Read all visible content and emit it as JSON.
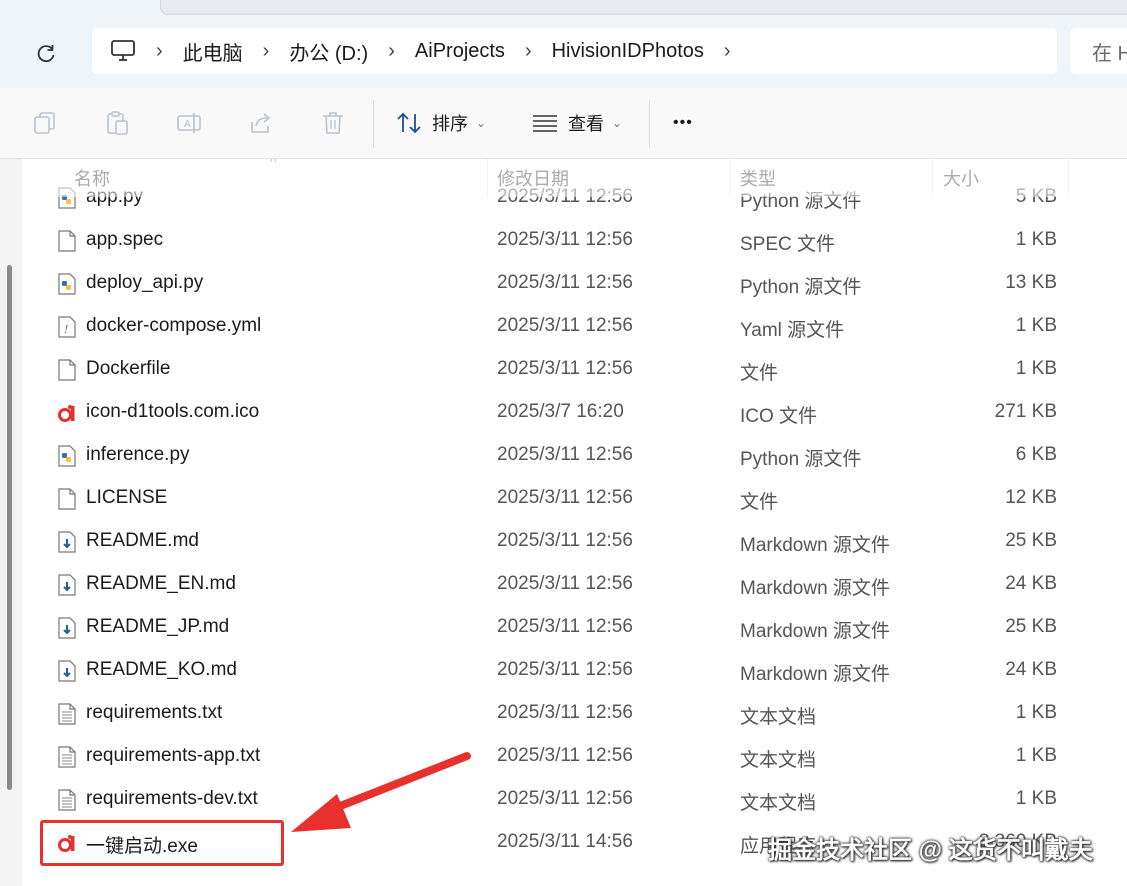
{
  "address": {
    "breadcrumbs": [
      "此电脑",
      "办公 (D:)",
      "AiProjects",
      "HivisionIDPhotos"
    ],
    "search_placeholder": "在 H"
  },
  "toolbar": {
    "sort_label": "排序",
    "view_label": "查看",
    "more_label": "•••"
  },
  "columns": {
    "name": "名称",
    "modified": "修改日期",
    "type": "类型",
    "size": "大小"
  },
  "files": [
    {
      "name": "app.py",
      "modified": "2025/3/11 12:56",
      "type": "Python 源文件",
      "size": "5 KB",
      "icon": "python-file-icon"
    },
    {
      "name": "app.spec",
      "modified": "2025/3/11 12:56",
      "type": "SPEC 文件",
      "size": "1 KB",
      "icon": "blank-file-icon"
    },
    {
      "name": "deploy_api.py",
      "modified": "2025/3/11 12:56",
      "type": "Python 源文件",
      "size": "13 KB",
      "icon": "python-file-icon"
    },
    {
      "name": "docker-compose.yml",
      "modified": "2025/3/11 12:56",
      "type": "Yaml 源文件",
      "size": "1 KB",
      "icon": "yaml-file-icon"
    },
    {
      "name": "Dockerfile",
      "modified": "2025/3/11 12:56",
      "type": "文件",
      "size": "1 KB",
      "icon": "blank-file-icon"
    },
    {
      "name": "icon-d1tools.com.ico",
      "modified": "2025/3/7 16:20",
      "type": "ICO 文件",
      "size": "271 KB",
      "icon": "app-logo-icon"
    },
    {
      "name": "inference.py",
      "modified": "2025/3/11 12:56",
      "type": "Python 源文件",
      "size": "6 KB",
      "icon": "python-file-icon"
    },
    {
      "name": "LICENSE",
      "modified": "2025/3/11 12:56",
      "type": "文件",
      "size": "12 KB",
      "icon": "blank-file-icon"
    },
    {
      "name": "README.md",
      "modified": "2025/3/11 12:56",
      "type": "Markdown 源文件",
      "size": "25 KB",
      "icon": "markdown-file-icon"
    },
    {
      "name": "README_EN.md",
      "modified": "2025/3/11 12:56",
      "type": "Markdown 源文件",
      "size": "24 KB",
      "icon": "markdown-file-icon"
    },
    {
      "name": "README_JP.md",
      "modified": "2025/3/11 12:56",
      "type": "Markdown 源文件",
      "size": "25 KB",
      "icon": "markdown-file-icon"
    },
    {
      "name": "README_KO.md",
      "modified": "2025/3/11 12:56",
      "type": "Markdown 源文件",
      "size": "24 KB",
      "icon": "markdown-file-icon"
    },
    {
      "name": "requirements.txt",
      "modified": "2025/3/11 12:56",
      "type": "文本文档",
      "size": "1 KB",
      "icon": "text-file-icon"
    },
    {
      "name": "requirements-app.txt",
      "modified": "2025/3/11 12:56",
      "type": "文本文档",
      "size": "1 KB",
      "icon": "text-file-icon"
    },
    {
      "name": "requirements-dev.txt",
      "modified": "2025/3/11 12:56",
      "type": "文本文档",
      "size": "1 KB",
      "icon": "text-file-icon"
    },
    {
      "name": "一键启动.exe",
      "modified": "2025/3/11 14:56",
      "type": "应用程序",
      "size": "3,360 KB",
      "icon": "app-logo-icon"
    }
  ],
  "annotation": {
    "highlight_color": "#e8312f"
  },
  "watermark": "掘金技术社区 @ 这货不叫戴夫"
}
